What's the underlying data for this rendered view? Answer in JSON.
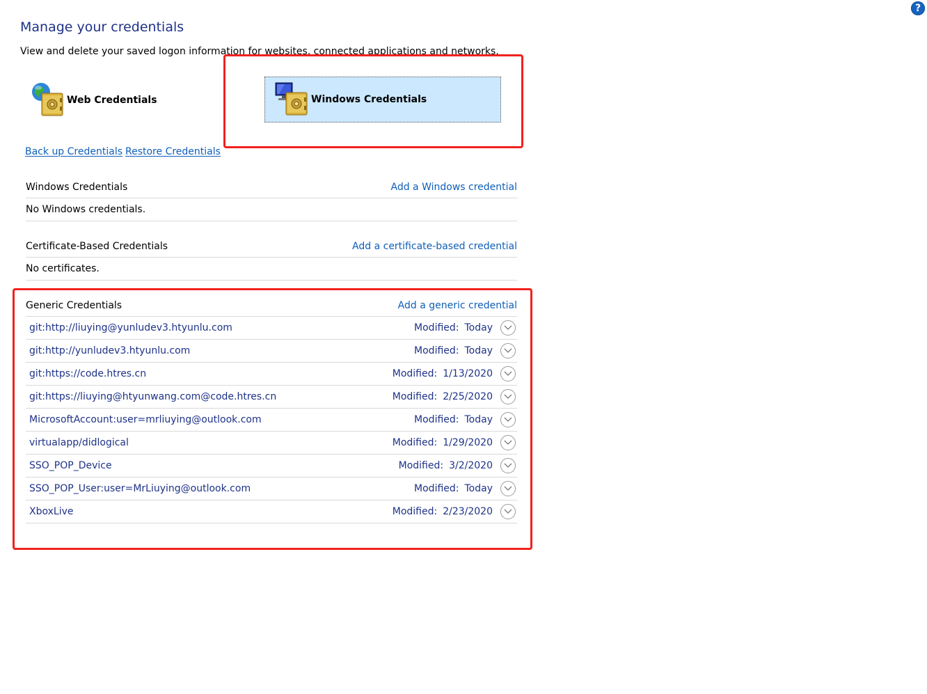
{
  "help": {
    "glyph": "?"
  },
  "title": "Manage your credentials",
  "subtitle": "View and delete your saved logon information for websites, connected applications and networks.",
  "credential_types": [
    {
      "label": "Web Credentials",
      "icon": "web-credentials-icon",
      "selected": false
    },
    {
      "label": "Windows Credentials",
      "icon": "windows-credentials-icon",
      "selected": true
    }
  ],
  "links": {
    "backup": "Back up Credentials",
    "restore": "Restore Credentials"
  },
  "windows_section": {
    "title": "Windows Credentials",
    "add_link": "Add a Windows credential",
    "empty_text": "No Windows credentials."
  },
  "certificate_section": {
    "title": "Certificate-Based Credentials",
    "add_link": "Add a certificate-based credential",
    "empty_text": "No certificates."
  },
  "generic_section": {
    "title": "Generic Credentials",
    "add_link": "Add a generic credential",
    "modified_label": "Modified:",
    "items": [
      {
        "name": "git:http://liuying@yunludev3.htyunlu.com",
        "modified": "Today"
      },
      {
        "name": "git:http://yunludev3.htyunlu.com",
        "modified": "Today"
      },
      {
        "name": "git:https://code.htres.cn",
        "modified": "1/13/2020"
      },
      {
        "name": "git:https://liuying@htyunwang.com@code.htres.cn",
        "modified": "2/25/2020"
      },
      {
        "name": "MicrosoftAccount:user=mrliuying@outlook.com",
        "modified": "Today"
      },
      {
        "name": "virtualapp/didlogical",
        "modified": "1/29/2020"
      },
      {
        "name": "SSO_POP_Device",
        "modified": "3/2/2020"
      },
      {
        "name": "SSO_POP_User:user=MrLiuying@outlook.com",
        "modified": "Today"
      },
      {
        "name": "XboxLive",
        "modified": "2/23/2020"
      }
    ]
  },
  "colors": {
    "title": "#1e3287",
    "link": "#0f5fb8",
    "selected_bg": "#cce8ff",
    "highlight": "#f0221e"
  }
}
